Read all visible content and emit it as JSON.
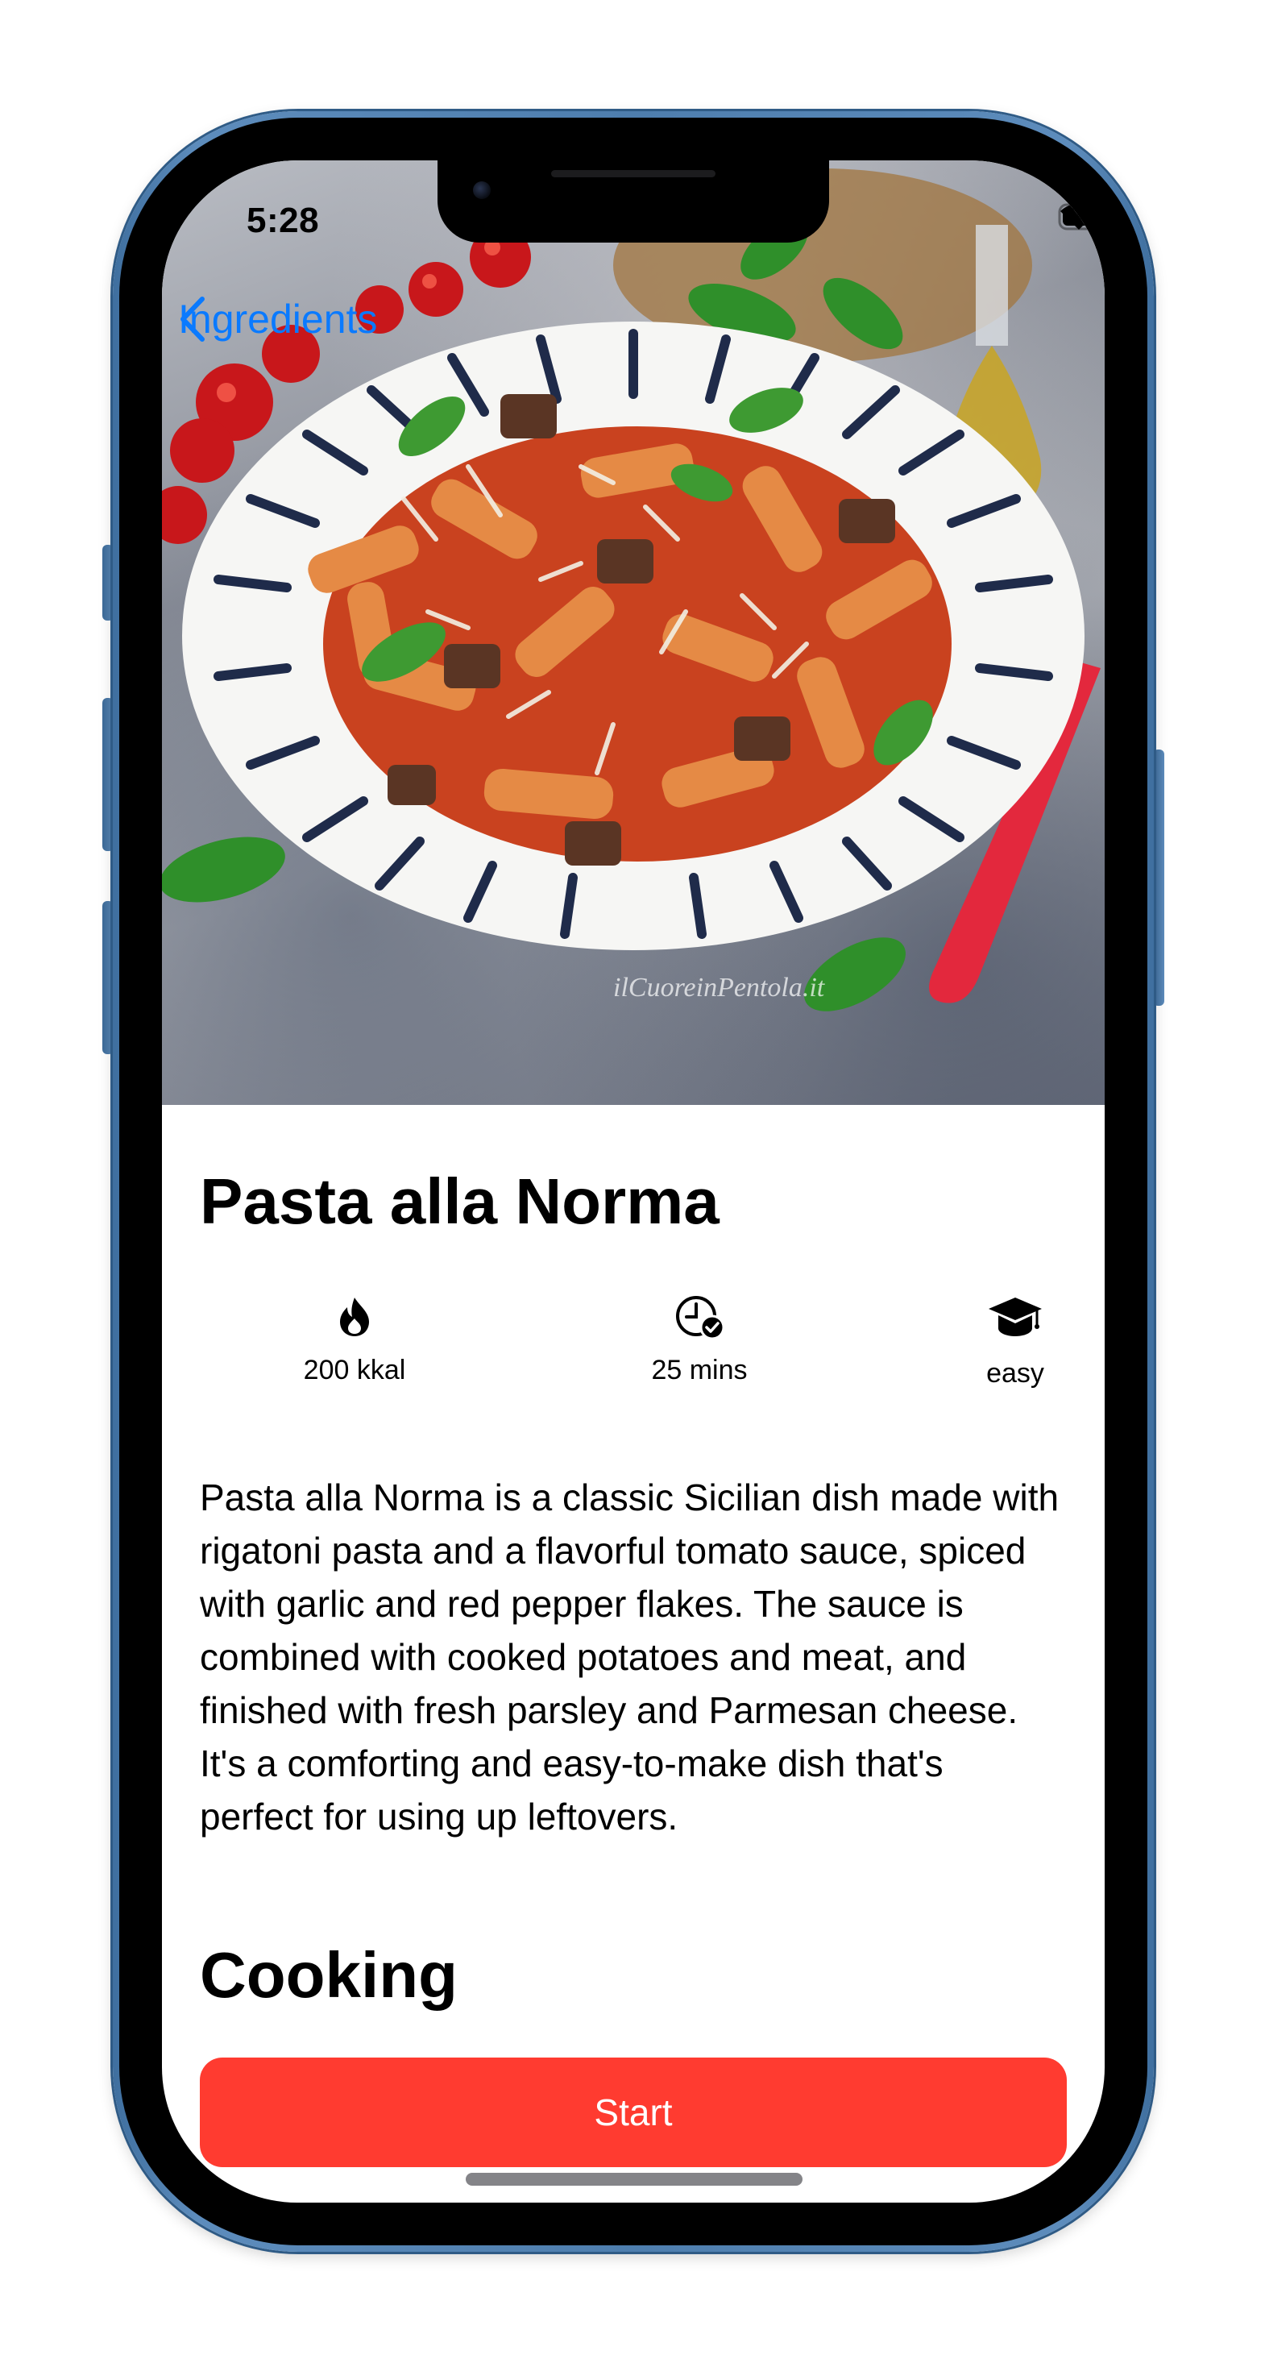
{
  "status_bar": {
    "time": "5:28",
    "icons": [
      "wifi-icon",
      "battery-icon"
    ]
  },
  "nav": {
    "back_label": "Ingredients",
    "back_icon": "chevron-left-icon",
    "accent_color": "#0a7aff"
  },
  "hero": {
    "image_description_icon": "pasta-dish-photo",
    "watermark": "ilCuoreinPentola.it"
  },
  "recipe": {
    "title": "Pasta alla Norma",
    "stats": [
      {
        "icon": "flame-icon",
        "label": "200 kkal"
      },
      {
        "icon": "clock-check-icon",
        "label": "25 mins"
      },
      {
        "icon": "graduation-cap-icon",
        "label": "easy"
      }
    ],
    "description": "Pasta alla Norma is a classic Sicilian dish made with rigatoni pasta and a flavorful tomato sauce, spiced with garlic and red pepper flakes. The sauce is combined with cooked potatoes and meat, and finished with fresh parsley and Parmesan cheese. It's a comforting and easy-to-make dish that's perfect for using up leftovers."
  },
  "cooking": {
    "section_title": "Cooking",
    "start_label": "Start",
    "button_color": "#ff3b30"
  }
}
